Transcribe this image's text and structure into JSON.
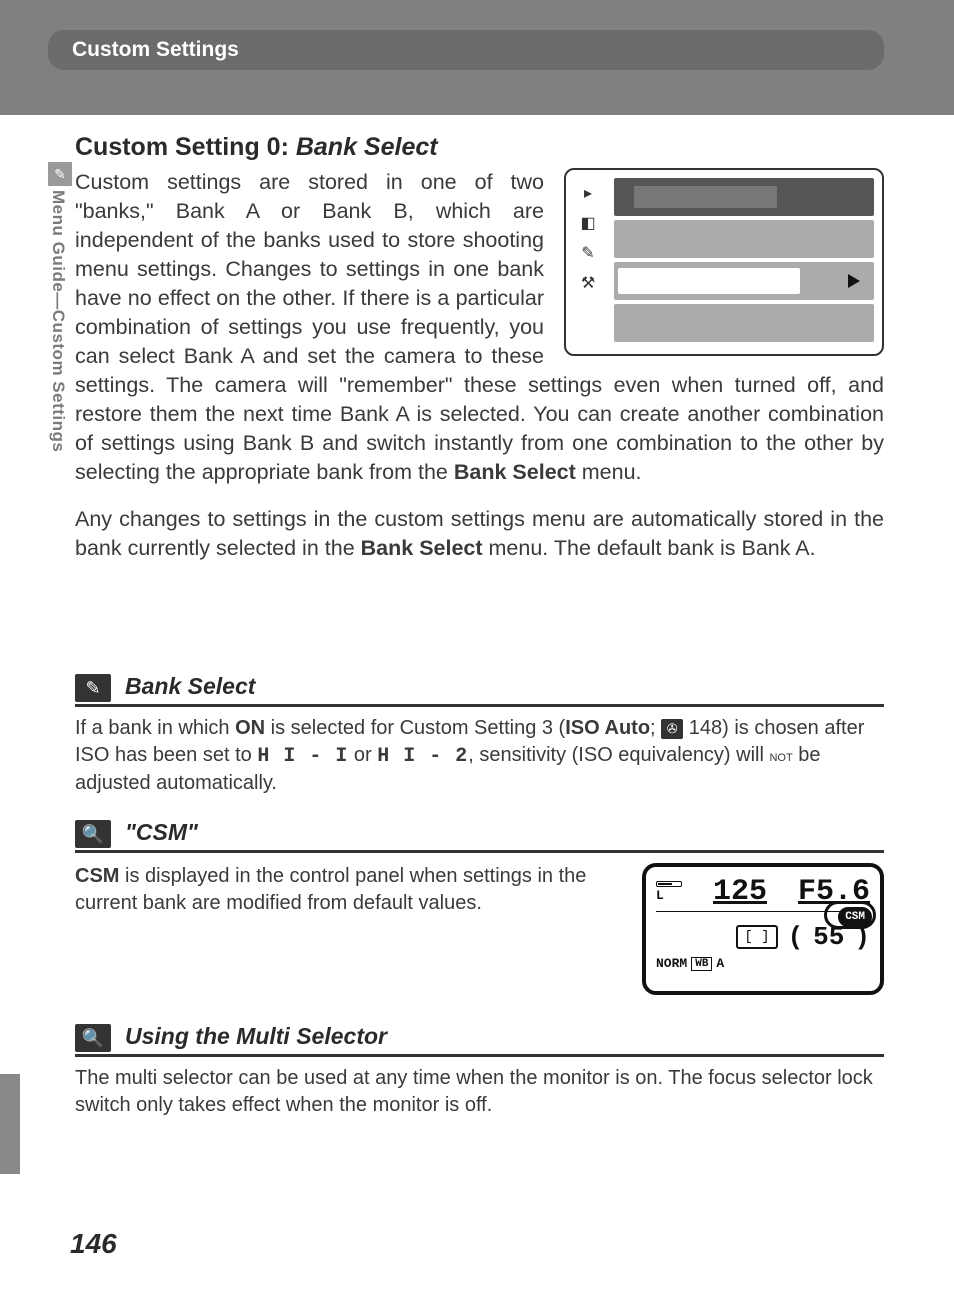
{
  "header": {
    "title": "Custom Settings"
  },
  "sidebar": {
    "label": "Menu Guide—Custom Settings"
  },
  "section": {
    "title_prefix": "Custom Setting 0: ",
    "title_italic": "Bank Select",
    "para1_a": "Custom settings are stored in one of two \"banks,\" Bank A or Bank B, which are independent of the banks used to store shooting menu settings.  Changes to settings in one bank have no effect on the other.  If there is a particular combination of settings you use frequently, you can select Bank A and set the camera to these settings.  The camera will \"remember\" these settings even when turned off, and restore them the next time Bank A is selected.  You can create another combination of settings using Bank B and switch instantly from one combination to the other by selecting the appropriate bank from the ",
    "para1_bold": "Bank Select",
    "para1_b": " menu.",
    "para2_a": "Any changes to settings in the custom settings menu are automatically stored in the bank currently selected in the ",
    "para2_bold": "Bank Select",
    "para2_b": " menu.  The default bank is Bank A."
  },
  "menu_illustration": {
    "icons": [
      "▣",
      "📷",
      "✎",
      "⚙"
    ]
  },
  "note_bank_select": {
    "title": "Bank Select",
    "body_a": "If a bank in which ",
    "body_on": "ON",
    "body_b": " is selected for Custom Setting 3 (",
    "body_iso_auto": "ISO Auto",
    "body_c": "; ",
    "page_ref": " 148) is chosen after ISO has been set to ",
    "hi1": "H I - I",
    "body_or": " or ",
    "hi2": "H I - 2",
    "body_d": ", sensitivity (ISO equivalency) will ",
    "not": "not",
    "body_e": " be adjusted automatically."
  },
  "note_csm": {
    "title": "\"CSM\"",
    "body_a": "CSM",
    "body_b": " is displayed in the control panel when settings in the current bank are modified from default values."
  },
  "lcd": {
    "shutter": "125",
    "aperture": "F5.6",
    "csm": "CSM",
    "bracket": "[ ]",
    "count": "55",
    "norm": "NORM",
    "wb": "WB",
    "wb_mode": "A"
  },
  "note_ms": {
    "title": "Using the Multi Selector",
    "body": "The multi selector can be used at any time when the monitor is on.  The focus selector lock switch only takes effect when the monitor is off."
  },
  "page_number": "146"
}
